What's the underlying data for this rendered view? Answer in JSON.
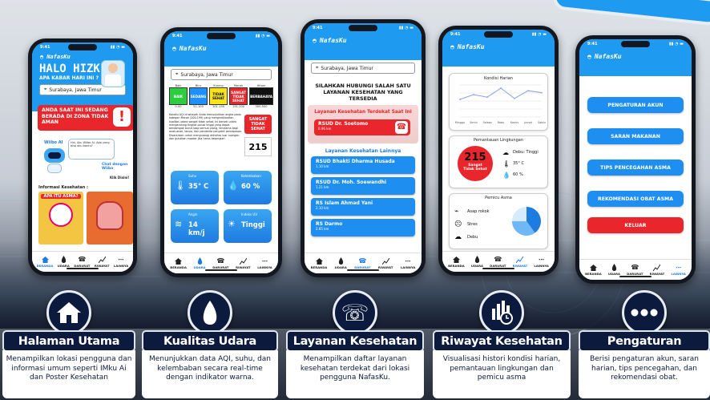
{
  "app_name": "NafasKu",
  "time": "9:41",
  "location": "Surabaya, Jawa Timur",
  "nav": [
    {
      "label": "BERANDA",
      "icon": "home-icon"
    },
    {
      "label": "UDARA",
      "icon": "drop-icon"
    },
    {
      "label": "DARURAT",
      "icon": "phone-icon"
    },
    {
      "label": "RIWAYAT",
      "icon": "chart-icon"
    },
    {
      "label": "LAINNYA",
      "icon": "more-icon"
    }
  ],
  "home": {
    "greeting": "HALO HIZKIA",
    "subgreeting": "APA KABAR HARI INI ?",
    "alert": "ANDA SAAT INI SEDANG BERADA DI ZONA TIDAK AMAN",
    "mascot_label": "Wiibo AI",
    "chat_prompt": "Chat dengan Wiibo",
    "click_hint": "Klik Disini!",
    "health_info_label": "Informasi Kesehatan :",
    "poster_title": "APA ITU ASMA?"
  },
  "udara": {
    "aqi_levels": [
      {
        "label": "Baik",
        "name": "BAIK",
        "range": "0-50",
        "color": "#2ecc40"
      },
      {
        "label": "Biru",
        "name": "SEDANG",
        "range": "51-100",
        "color": "#1e90ff"
      },
      {
        "label": "Kuning",
        "name": "TIDAK SEHAT",
        "range": "101-150",
        "color": "#f9e31c"
      },
      {
        "label": "Merah",
        "name": "SANGAT TIDAK SEHAT",
        "range": "151-200",
        "color": "#e8262b"
      },
      {
        "label": "Hitam",
        "name": "BERBAHAYA",
        "range": "300-500",
        "color": "#111111"
      }
    ],
    "description": "Kondisi AQI di wilayah Anda menunjukkan angka pada kategori Merah (200-199) yang mengindikasikan kualitas udara sangat tidak sehat. Ini berarti udara mengandung tingkat polusi tinggi yang dapat berdampak buruk bagi semua orang, terutama bagi anak-anak, lansia, dan penderita penyakit pernapasan. Disarankan untuk mengurangi aktivitas luar ruangan dan gunakan masker jika harus bepergian.",
    "status": "SANGAT TIDAK SEHAT",
    "aqi_value": "215",
    "tiles": [
      {
        "label": "Suhu",
        "value": "35° C",
        "icon": "thermometer-icon"
      },
      {
        "label": "Kelembaban",
        "value": "60 %",
        "icon": "humidity-icon"
      },
      {
        "label": "Angin",
        "value": "14 km/j",
        "icon": "wind-icon"
      },
      {
        "label": "Indeks UV",
        "value": "Tinggi",
        "icon": "sun-icon"
      }
    ]
  },
  "darurat": {
    "heading": "SILAHKAN HUBUNGI SALAH SATU LAYANAN KESEHATAN YANG TERSEDIA",
    "nearest_label": "Layanan Kesehatan Terdekat Saat Ini",
    "nearest": {
      "name": "RSUD Dr. Soetomo",
      "dist": "0.96 km"
    },
    "others_label": "Layanan Kesehatan Lainnya",
    "others": [
      {
        "name": "RSUD Bhakti Dharma Husada",
        "dist": "1.10 km"
      },
      {
        "name": "RSUD Dr. Moh. Soewandhi",
        "dist": "1.21 km"
      },
      {
        "name": "RS Islam Ahmad Yani",
        "dist": "2.10 km"
      },
      {
        "name": "RS Darmo",
        "dist": "2.85 km"
      }
    ]
  },
  "riwayat": {
    "daily_title": "Kondisi Harian",
    "days": [
      "Minggu",
      "Senin",
      "Selasa",
      "Rabu",
      "Kamis",
      "Jumat",
      "Sabtu"
    ],
    "daily_values": [
      55,
      70,
      62,
      90,
      58,
      82,
      76
    ],
    "monitor_title": "Pemantauan Lingkungan",
    "aqi_value": "215",
    "aqi_status": "Sangat Tidak Sehat",
    "metrics": [
      {
        "icon": "dust-icon",
        "value": "Debu: Tinggi"
      },
      {
        "icon": "thermometer-icon",
        "value": "35° C"
      },
      {
        "icon": "humidity-icon",
        "value": "60 %"
      }
    ],
    "trigger_title": "Pemicu Asma",
    "triggers": [
      {
        "icon": "smoke-icon",
        "label": "Asap rokok"
      },
      {
        "icon": "stress-icon",
        "label": "Stres"
      },
      {
        "icon": "dust-icon",
        "label": "Debu"
      }
    ],
    "pie_values": [
      40,
      35,
      25
    ],
    "pie_colors": [
      "#1e7be0",
      "#6fb8f5",
      "#d6ecfc"
    ]
  },
  "lainnya": {
    "menu": [
      "PENGATURAN AKUN",
      "SARAN MAKANAN",
      "TIPS PENCEGAHAN ASMA",
      "REKOMENDASI OBAT ASMA"
    ],
    "logout": "KELUAR"
  },
  "features": [
    {
      "title": "Halaman Utama",
      "desc": "Menampilkan lokasi pengguna dan informasi umum seperti IMku Ai dan Poster Kesehatan",
      "icon": "home-icon"
    },
    {
      "title": "Kualitas Udara",
      "desc": "Menunjukkan data AQI, suhu, dan kelembaban secara real-time dengan indikator warna.",
      "icon": "drop-icon"
    },
    {
      "title": "Layanan Kesehatan",
      "desc": "Menampilkan daftar layanan kesehatan terdekat dari lokasi pengguna NafasKu.",
      "icon": "phone-icon"
    },
    {
      "title": "Riwayat Kesehatan",
      "desc": "Visualisasi histori kondisi harian, pemantauan lingkungan dan pemicu asma",
      "icon": "history-icon"
    },
    {
      "title": "Pengaturan",
      "desc": "Berisi pengaturan akun, saran harian, tips pencegahan, dan rekomendasi obat.",
      "icon": "more-icon"
    }
  ],
  "colors": {
    "primary": "#1e9bf0",
    "danger": "#e8262b",
    "navy": "#0c1a3d"
  }
}
